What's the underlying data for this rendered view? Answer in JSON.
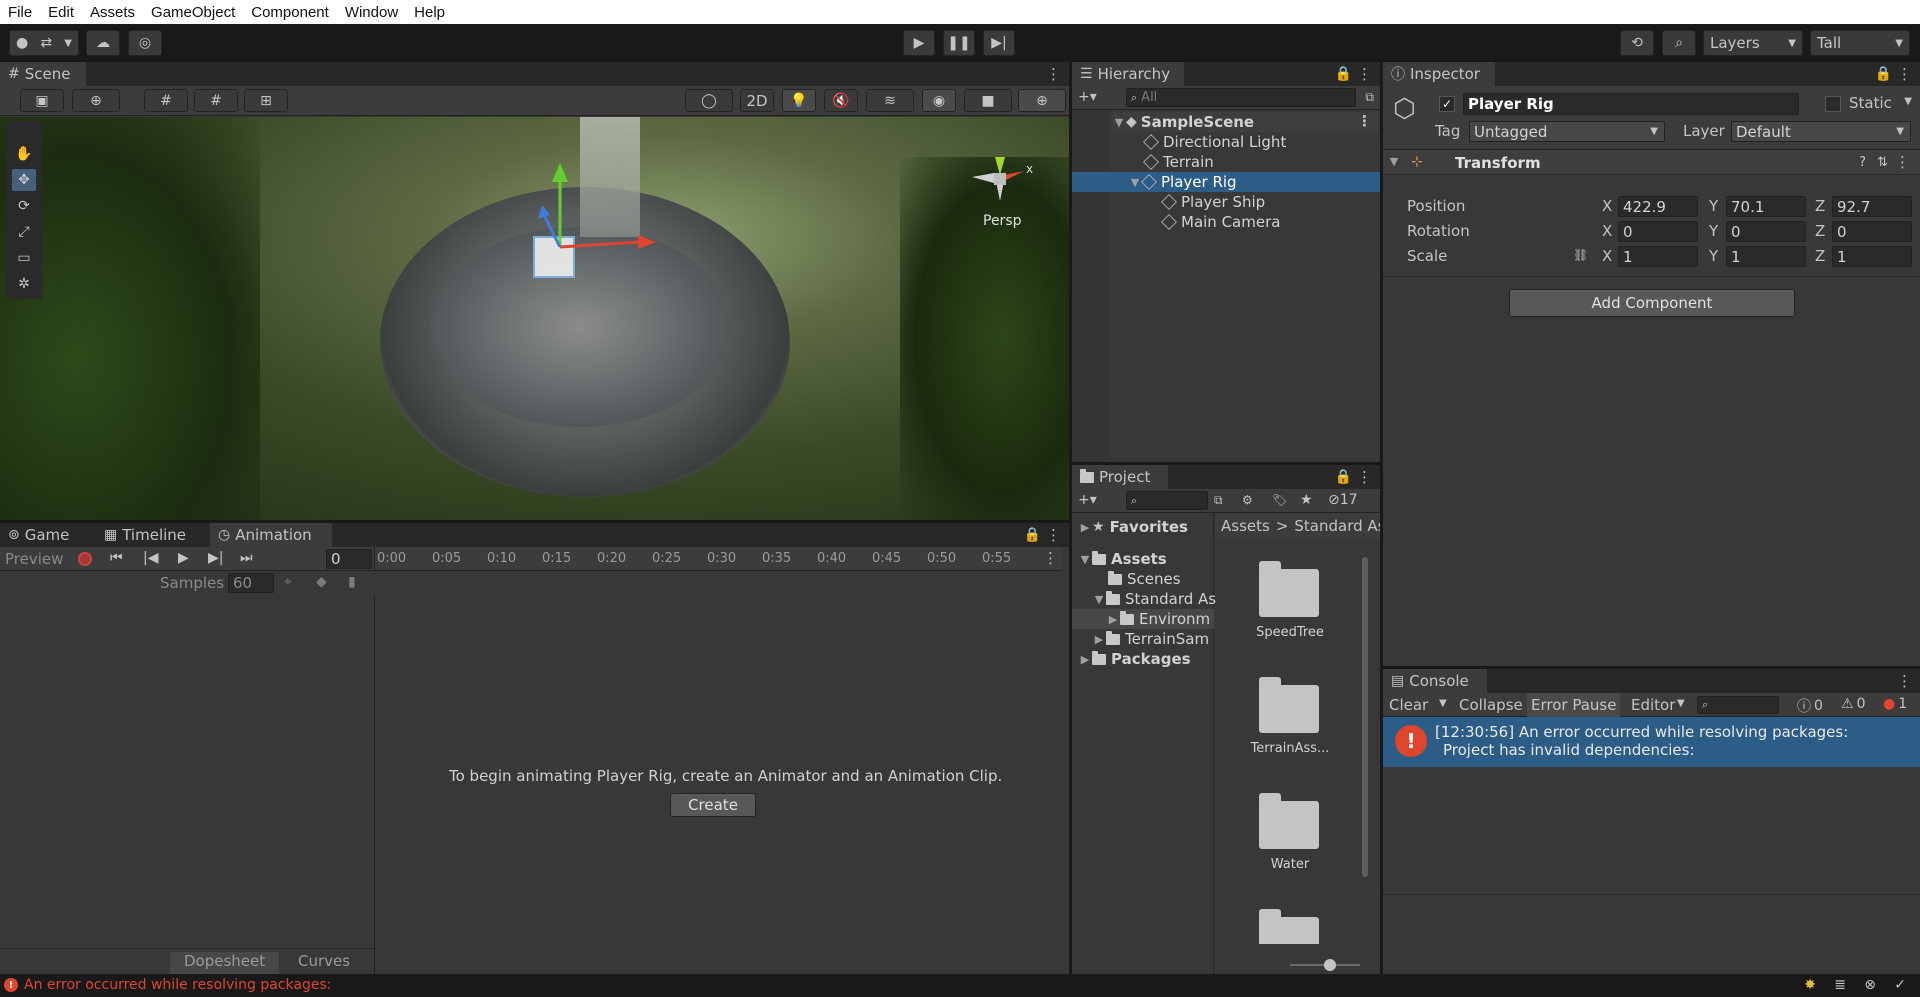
{
  "menu": [
    "File",
    "Edit",
    "Assets",
    "GameObject",
    "Component",
    "Window",
    "Help"
  ],
  "toolbar": {
    "layers_label": "Layers",
    "layout_label": "Tall"
  },
  "scene": {
    "tab_label": "Scene",
    "mode_2d": "2D",
    "persp_label": "Persp",
    "gizmo_axis_x": "x"
  },
  "bottom_left": {
    "tabs": [
      "Game",
      "Timeline",
      "Animation"
    ],
    "preview_label": "Preview",
    "frame_value": "0",
    "samples_label": "Samples",
    "samples_value": "60",
    "timeline_ticks": [
      "0:00",
      "0:05",
      "0:10",
      "0:15",
      "0:20",
      "0:25",
      "0:30",
      "0:35",
      "0:40",
      "0:45",
      "0:50",
      "0:55"
    ],
    "message": "To begin animating Player Rig, create an Animator and an Animation Clip.",
    "create_button": "Create",
    "dopesheet_label": "Dopesheet",
    "curves_label": "Curves"
  },
  "hierarchy": {
    "tab_label": "Hierarchy",
    "search_placeholder": "All",
    "scene_name": "SampleScene",
    "items": [
      {
        "label": "Directional Light"
      },
      {
        "label": "Terrain"
      },
      {
        "label": "Player Rig"
      },
      {
        "label": "Player Ship"
      },
      {
        "label": "Main Camera"
      }
    ]
  },
  "project": {
    "tab_label": "Project",
    "hidden_count": "17",
    "favorites_label": "Favorites",
    "assets_label": "Assets",
    "tree": [
      "Scenes",
      "Standard As",
      "Environm",
      "TerrainSam"
    ],
    "packages_label": "Packages",
    "breadcrumb_root": "Assets",
    "breadcrumb_sep": ">",
    "breadcrumb_current": "Standard Ass",
    "folders": [
      "SpeedTree",
      "TerrainAss...",
      "Water"
    ]
  },
  "inspector": {
    "tab_label": "Inspector",
    "object_name": "Player Rig",
    "static_label": "Static",
    "tag_label": "Tag",
    "tag_value": "Untagged",
    "layer_label": "Layer",
    "layer_value": "Default",
    "component_name": "Transform",
    "position_label": "Position",
    "rotation_label": "Rotation",
    "scale_label": "Scale",
    "axis": [
      "X",
      "Y",
      "Z"
    ],
    "position": [
      "422.9",
      "70.1",
      "92.7"
    ],
    "rotation": [
      "0",
      "0",
      "0"
    ],
    "scale": [
      "1",
      "1",
      "1"
    ],
    "add_component": "Add Component"
  },
  "console": {
    "tab_label": "Console",
    "clear_label": "Clear",
    "collapse_label": "Collapse",
    "error_pause_label": "Error Pause",
    "editor_label": "Editor",
    "info_count": "0",
    "warn_count": "0",
    "error_count": "1",
    "message_line1": "[12:30:56] An error occurred while resolving packages:",
    "message_line2": "Project has invalid dependencies:"
  },
  "status_bar": {
    "message": "An error occurred while resolving packages:"
  },
  "colors": {
    "selection": "#2c5d87",
    "error_red": "#e0452d",
    "panel_bg": "#383838",
    "toolbar_bg": "#191919"
  }
}
